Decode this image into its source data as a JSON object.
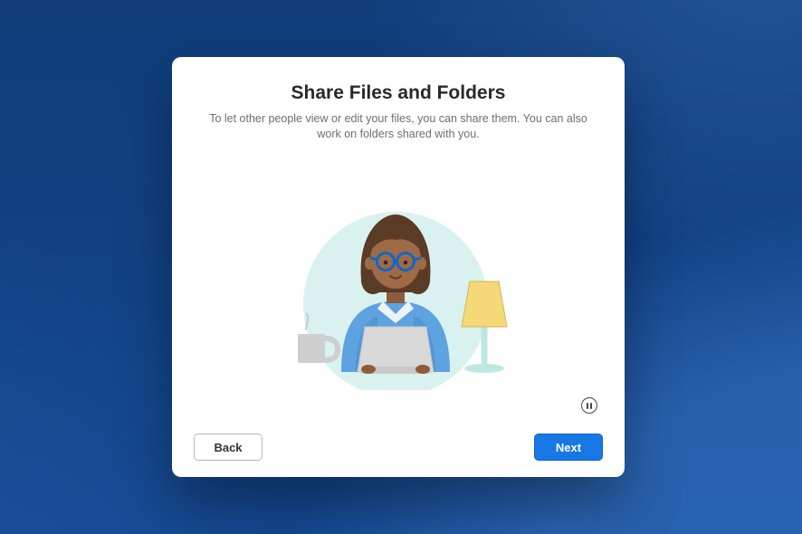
{
  "dialog": {
    "title": "Share Files and Folders",
    "subtitle": "To let other people view or edit your files, you can share them. You can also work on folders shared with you.",
    "back_label": "Back",
    "next_label": "Next",
    "pause_tooltip": "Pause"
  },
  "illustration": {
    "name": "person-at-laptop-with-lamp-and-mug",
    "circle_bg": "#d9f2ef",
    "sweater": "#5ea3df",
    "sweater_dark": "#3a7fc2",
    "hair": "#5a3b26",
    "skin": "#9e6b46",
    "glasses": "#1266c7",
    "laptop": "#d9d9d9",
    "lamp_shade": "#f5d878",
    "lamp_base": "#bfe7e1",
    "mug": "#cfcfcf"
  },
  "colors": {
    "background": "#12468f",
    "dialog_bg": "#ffffff",
    "primary_button": "#1677e5",
    "text_secondary": "#6e6e73"
  }
}
